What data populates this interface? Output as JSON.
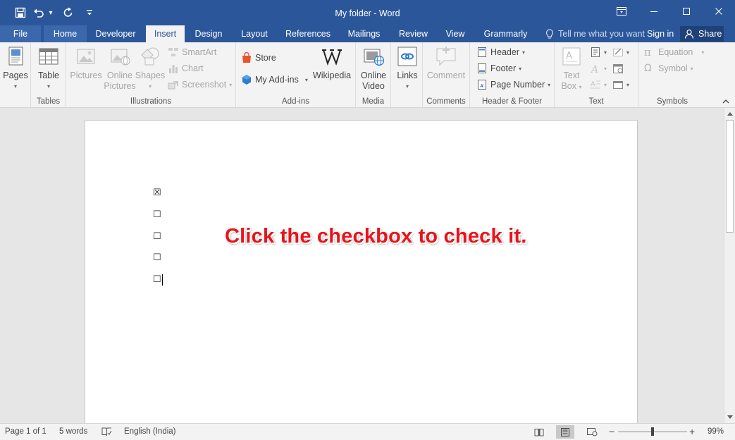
{
  "window": {
    "title": "My folder - Word"
  },
  "qat": {
    "save": "save-icon",
    "undo": "undo-icon",
    "redo": "redo-icon",
    "customize": "customize-icon"
  },
  "tabs": [
    {
      "label": "File"
    },
    {
      "label": "Home"
    },
    {
      "label": "Developer"
    },
    {
      "label": "Insert"
    },
    {
      "label": "Design"
    },
    {
      "label": "Layout"
    },
    {
      "label": "References"
    },
    {
      "label": "Mailings"
    },
    {
      "label": "Review"
    },
    {
      "label": "View"
    },
    {
      "label": "Grammarly"
    }
  ],
  "active_tab": "Insert",
  "tell_me": {
    "placeholder": "Tell me what you want"
  },
  "account": {
    "sign_in": "Sign in",
    "share": "Share"
  },
  "ribbon": {
    "pages": {
      "label": "Pages",
      "group": ""
    },
    "tables": {
      "table": "Table",
      "group": "Tables"
    },
    "illustrations": {
      "pictures": "Pictures",
      "online_pictures_1": "Online",
      "online_pictures_2": "Pictures",
      "shapes": "Shapes",
      "smartart": "SmartArt",
      "chart": "Chart",
      "screenshot": "Screenshot",
      "group": "Illustrations"
    },
    "addins": {
      "store": "Store",
      "my_addins": "My Add-ins",
      "wikipedia": "Wikipedia",
      "group": "Add-ins"
    },
    "media": {
      "online_video_1": "Online",
      "online_video_2": "Video",
      "group": "Media"
    },
    "links": {
      "links": "Links",
      "group": ""
    },
    "comments": {
      "comment": "Comment",
      "group": "Comments"
    },
    "header_footer": {
      "header": "Header",
      "footer": "Footer",
      "page_number": "Page Number",
      "group": "Header & Footer"
    },
    "text": {
      "text_box_1": "Text",
      "text_box_2": "Box",
      "group": "Text"
    },
    "symbols": {
      "equation": "Equation",
      "symbol": "Symbol",
      "group": "Symbols"
    }
  },
  "document": {
    "checkboxes": [
      {
        "glyph": "☒",
        "checked": true
      },
      {
        "glyph": "☐",
        "checked": false
      },
      {
        "glyph": "☐",
        "checked": false
      },
      {
        "glyph": "☐",
        "checked": false
      },
      {
        "glyph": "☐",
        "checked": false
      }
    ],
    "instruction": "Click the checkbox to check it."
  },
  "status": {
    "page": "Page 1 of 1",
    "words": "5 words",
    "language": "English (India)",
    "zoom": "99%",
    "zoom_level": 0.99
  },
  "colors": {
    "title_bar": "#2b579a",
    "instruction_text": "#e8141a"
  }
}
